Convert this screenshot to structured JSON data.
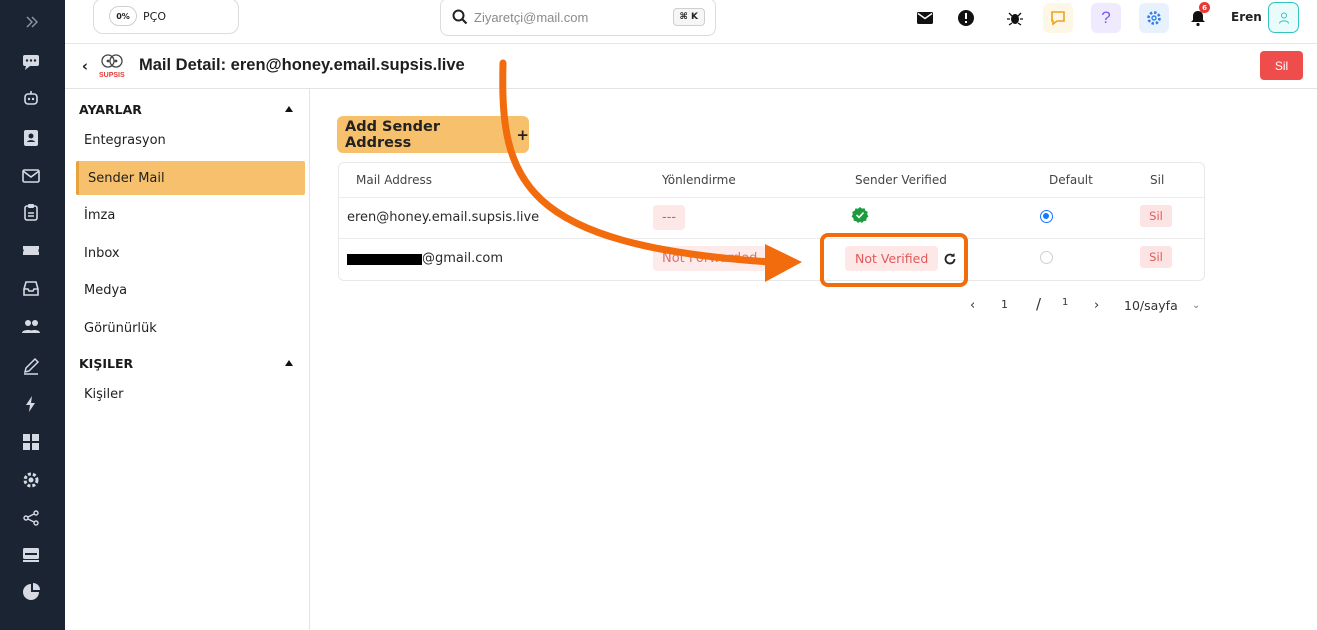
{
  "topbar": {
    "status_percent": "0%",
    "status_label": "PÇO",
    "search_placeholder": "Ziyaretçi@mail.com",
    "search_shortcut": "⌘ K",
    "notification_count": "6",
    "user_name": "Eren"
  },
  "header": {
    "logo_text": "SUPSIS",
    "title": "Mail Detail: eren@honey.email.supsis.live",
    "delete_label": "Sil"
  },
  "settings": {
    "sections": [
      {
        "title": "AYARLAR",
        "items": [
          "Entegrasyon",
          "Sender Mail",
          "İmza",
          "Inbox",
          "Medya",
          "Görünürlük"
        ],
        "active": "Sender Mail"
      },
      {
        "title": "KIŞILER",
        "items": [
          "Kişiler"
        ]
      }
    ]
  },
  "main": {
    "add_button_label": "Add Sender Address",
    "table": {
      "columns": [
        "Mail Address",
        "Yönlendirme",
        "Sender Verified",
        "Default",
        "Sil"
      ],
      "rows": [
        {
          "mail": "eren@honey.email.supsis.live",
          "forwarding": "---",
          "verified": true,
          "default": true,
          "delete": "Sil"
        },
        {
          "mail": "@gmail.com",
          "forwarding": "Not Forwarded",
          "verified_label": "Not Verified",
          "default": false,
          "delete": "Sil"
        }
      ]
    },
    "pagination": {
      "current": "1",
      "separator": "/",
      "total": "1",
      "page_size": "10/sayfa"
    }
  },
  "colors": {
    "rail_bg": "#1b2433",
    "accent_orange": "#f7c06c",
    "danger": "#ef4c4c",
    "annotation": "#f26b0c",
    "verified_green": "#1a9d3c"
  }
}
